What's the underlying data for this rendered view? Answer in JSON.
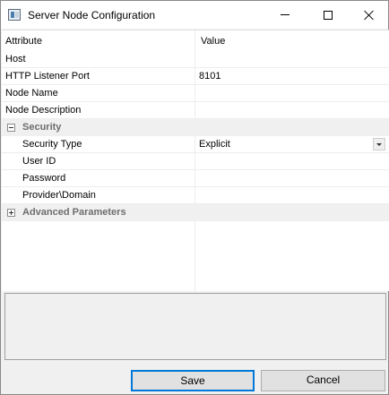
{
  "window": {
    "title": "Server Node Configuration"
  },
  "grid": {
    "header": {
      "attribute": "Attribute",
      "value": "Value"
    },
    "rows": [
      {
        "name": "Host",
        "value": ""
      },
      {
        "name": "HTTP Listener Port",
        "value": "8101"
      },
      {
        "name": "Node Name",
        "value": ""
      },
      {
        "name": "Node Description",
        "value": ""
      }
    ],
    "security": {
      "label": "Security",
      "expanded": true,
      "rows": [
        {
          "name": "Security Type",
          "value": "Explicit"
        },
        {
          "name": "User ID",
          "value": ""
        },
        {
          "name": "Password",
          "value": ""
        },
        {
          "name": "Provider\\Domain",
          "value": ""
        }
      ]
    },
    "advanced": {
      "label": "Advanced Parameters",
      "expanded": false
    }
  },
  "buttons": {
    "save": "Save",
    "cancel": "Cancel"
  },
  "colors": {
    "default_button_border": "#0078d7",
    "category_text": "#6d6d6d"
  }
}
